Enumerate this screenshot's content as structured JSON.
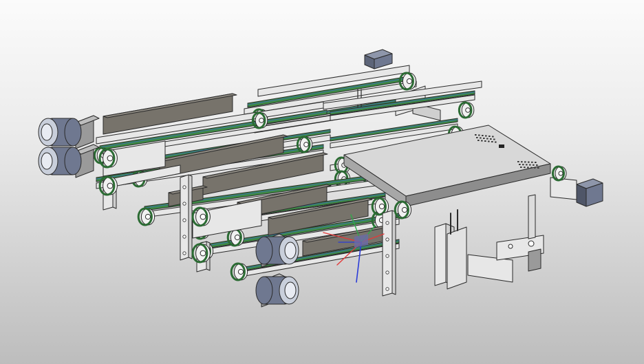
{
  "viewport": {
    "background_top": "#fbfbfb",
    "background_bottom": "#bdbdbd"
  },
  "model": {
    "colors": {
      "frame": "#e7e7e7",
      "frame_dark": "#cfcfcf",
      "belt": "#3e8a45",
      "belt_dark": "#2b6b33",
      "guard": "#77736b",
      "guard_light": "#8e8a82",
      "motor": "#6f7890",
      "motor_dark": "#545b6e",
      "outline": "#2a2a2a",
      "rail": "#3b6fa8"
    },
    "axis_triad": {
      "x": "#e23a3a",
      "y": "#2fa84a",
      "z": "#2a3bd8"
    },
    "components": [
      "motor-icon",
      "conveyor-belt-icon",
      "side-guard-icon",
      "pulley-icon",
      "cylinder-icon",
      "control-box-icon"
    ]
  }
}
